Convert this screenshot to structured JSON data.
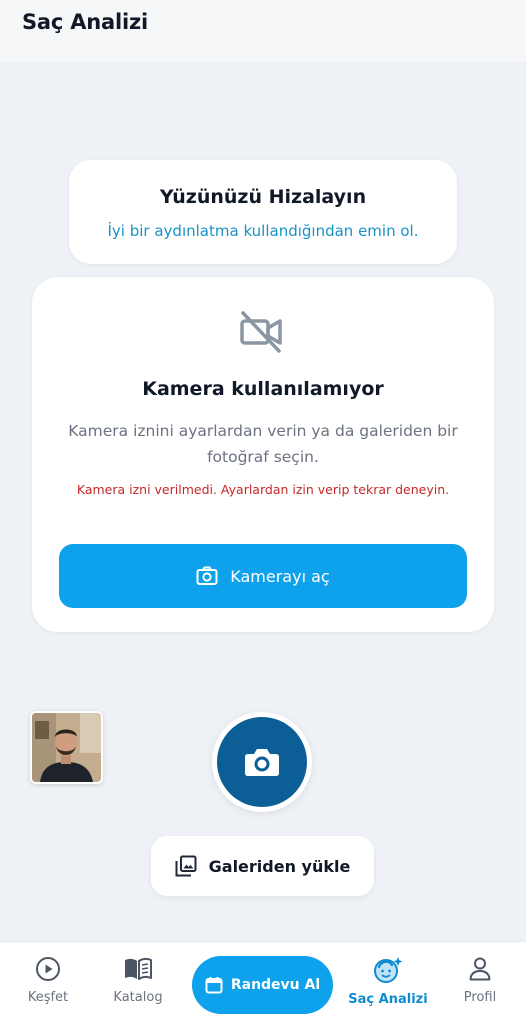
{
  "header": {
    "title": "Saç Analizi"
  },
  "align_card": {
    "title": "Yüzünüzü Hizalayın",
    "subtitle": "İyi bir aydınlatma kullandığından emin ol."
  },
  "camera_card": {
    "icon": "camera-off-icon",
    "title": "Kamera kullanılamıyor",
    "description": "Kamera iznini ayarlardan verin ya da galeriden bir fotoğraf seçin.",
    "error": "Kamera izni verilmedi. Ayarlardan izin verip tekrar deneyin.",
    "open_camera_label": "Kamerayı aç"
  },
  "gallery_button": {
    "label": "Galeriden yükle",
    "icon": "gallery-icon"
  },
  "bottom_nav": {
    "items": [
      {
        "label": "Keşfet",
        "icon": "play-circle-icon",
        "active": false
      },
      {
        "label": "Katalog",
        "icon": "book-icon",
        "active": false
      },
      {
        "label": "Randevu Al",
        "icon": "calendar-icon",
        "active": false
      },
      {
        "label": "Saç Analizi",
        "icon": "face-sparkle-icon",
        "active": true
      },
      {
        "label": "Profil",
        "icon": "person-icon",
        "active": false
      }
    ]
  },
  "colors": {
    "accent": "#0ea1ec",
    "shutter": "#0b5f96",
    "error": "#c62828",
    "active_nav": "#0e8ccf",
    "background": "#eef1f5"
  }
}
